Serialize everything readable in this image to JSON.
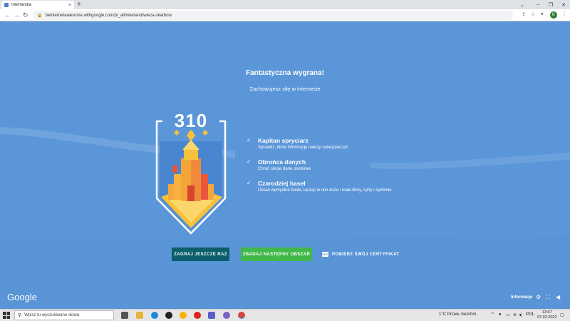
{
  "browser": {
    "tab_title": "Interlandia",
    "tab_close": "×",
    "new_tab": "+",
    "url": "beinternetawesome.withgoogle.com/pl_all/interland/wieza-skarbow",
    "win_minimize": "–",
    "win_restore": "❐",
    "win_close": "✕",
    "win_dropdown": "⌄",
    "back": "←",
    "forward": "→",
    "reload": "↻",
    "profile_initial": "K"
  },
  "page": {
    "title": "Fantastyczna wygrana!",
    "subtitle": "Zachowujesz siłę w internecie",
    "score": "310",
    "achievements": [
      {
        "title": "Kapitan spryciarz",
        "desc": "Sprawdź, które informacje należy zabezpieczać"
      },
      {
        "title": "Obrońca danych",
        "desc": "Chroń swoje dane osobowe"
      },
      {
        "title": "Czarodziej haseł",
        "desc": "Ustaw wymyślne hasło, łącząc w nim duże i małe litery, cyfry i symbole"
      }
    ],
    "buttons": {
      "play_again": "ZAGRAJ JESZCZE RAZ",
      "next_area": "ZBADAJ NASTĘPNY OBSZAR",
      "certificate": "POBIERZ SWÓJ CERTYFIKAT",
      "pdf_label": "PDF"
    },
    "footer": {
      "logo": "Google",
      "info": "Informacje"
    },
    "colors": {
      "background": "#5b96d8",
      "play_again": "#0b5e6b",
      "next_area": "#41b84a"
    }
  },
  "taskbar": {
    "search_placeholder": "Wpisz tu wyszukiwane słowa",
    "weather": "1°C  Przew. bezchm.",
    "language": "POL",
    "time": "13:07",
    "date": "07.02.2022"
  }
}
